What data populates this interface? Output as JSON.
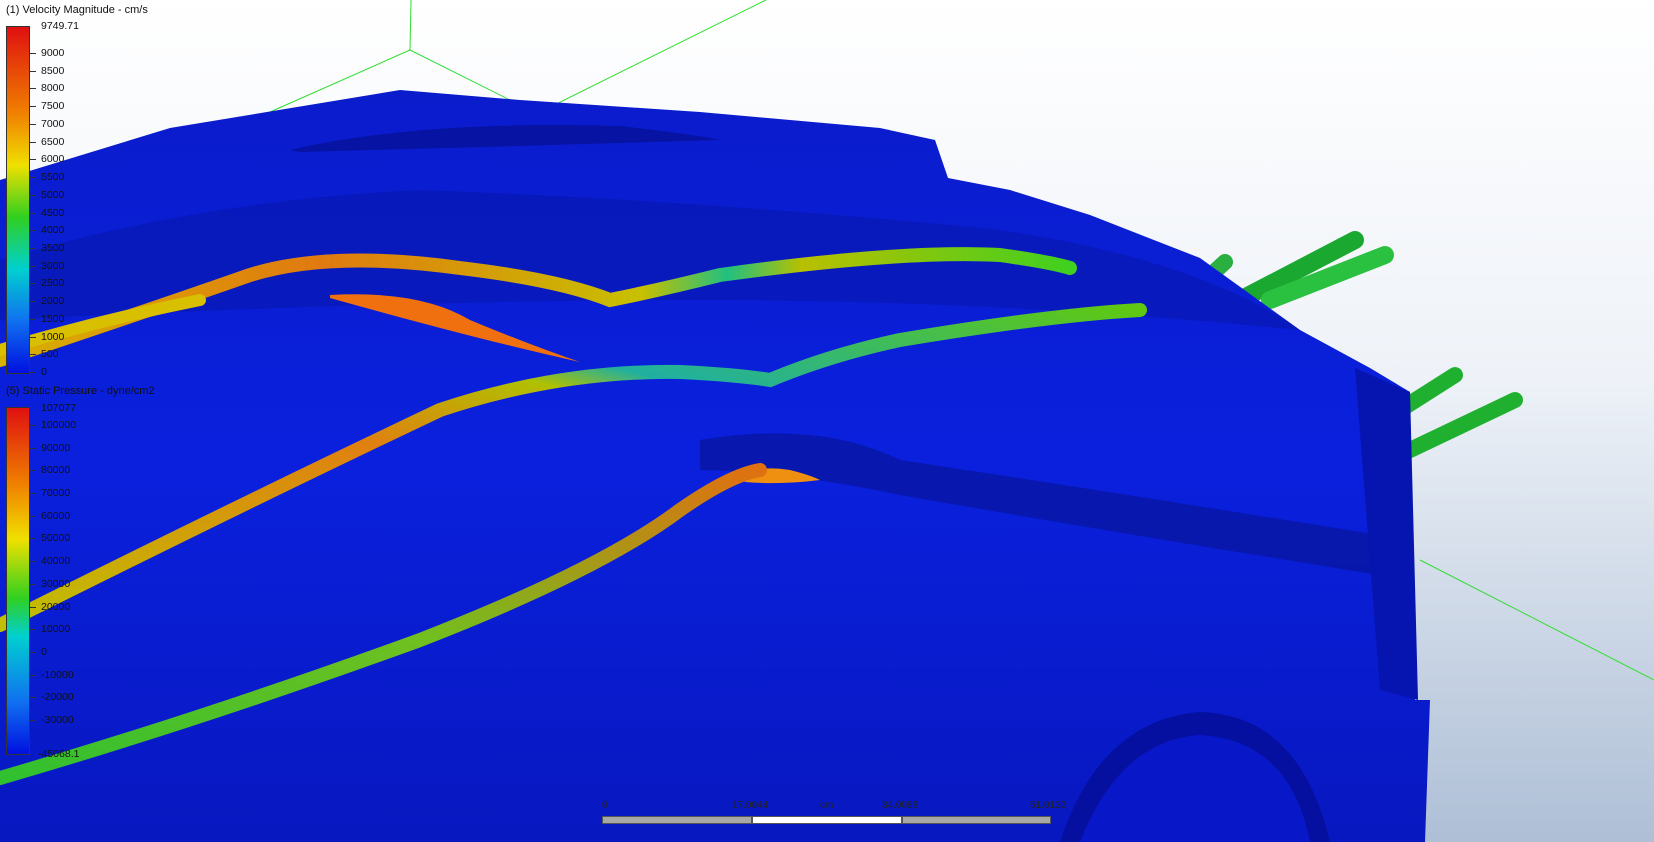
{
  "velocity_legend": {
    "title": "(1) Velocity Magnitude - cm/s",
    "max_label": "9749.71",
    "ticks": [
      "9000",
      "8500",
      "8000",
      "7500",
      "7000",
      "6500",
      "6000",
      "5500",
      "5000",
      "4500",
      "4000",
      "3500",
      "3000",
      "2500",
      "2000",
      "1500",
      "1000",
      "500",
      "0"
    ]
  },
  "pressure_legend": {
    "title": "(5) Static Pressure - dyne/cm2",
    "max_label": "107077",
    "ticks": [
      "100000",
      "90000",
      "80000",
      "70000",
      "60000",
      "50000",
      "40000",
      "30000",
      "20000",
      "10000",
      "0",
      "-10000",
      "-20000",
      "-30000"
    ],
    "min_label": "-45068.1"
  },
  "scale_bar": {
    "labels": [
      "0",
      "17.0044",
      "cm",
      "34.0088",
      "51.0132"
    ]
  },
  "colors": {
    "background_top": "#ffffff",
    "background_bottom": "#aebfd6",
    "body_blue": "#0a1fd6",
    "triad_green": "#33dd33"
  }
}
